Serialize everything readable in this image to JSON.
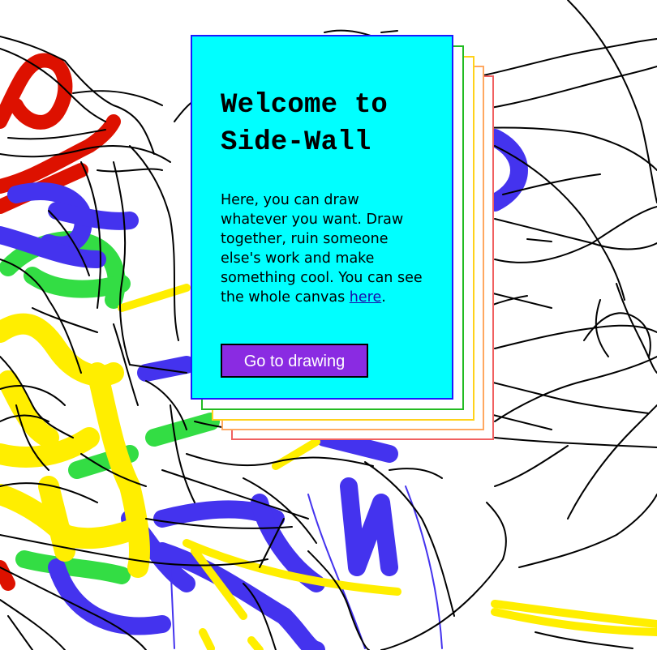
{
  "welcome": {
    "title_line1": "Welcome to",
    "title_line2": "Side-Wall",
    "text_before_link": "Here, you can draw whatever you want. Draw together, ruin someone else's work and make something cool. You can see the whole canvas ",
    "link_text": "here",
    "text_after_link": ".",
    "button_label": "Go to drawing"
  },
  "colors": {
    "card_background": "#00ffff",
    "card_border": "#1a1aff",
    "button_background": "#8a2be2",
    "stack_borders": [
      "#22bb22",
      "#ffd21a",
      "#ffa860",
      "#f06060"
    ],
    "stroke_red": "#dd1100",
    "stroke_blue": "#4433ee",
    "stroke_green": "#33dd44",
    "stroke_yellow": "#ffee00",
    "stroke_black": "#000000"
  }
}
